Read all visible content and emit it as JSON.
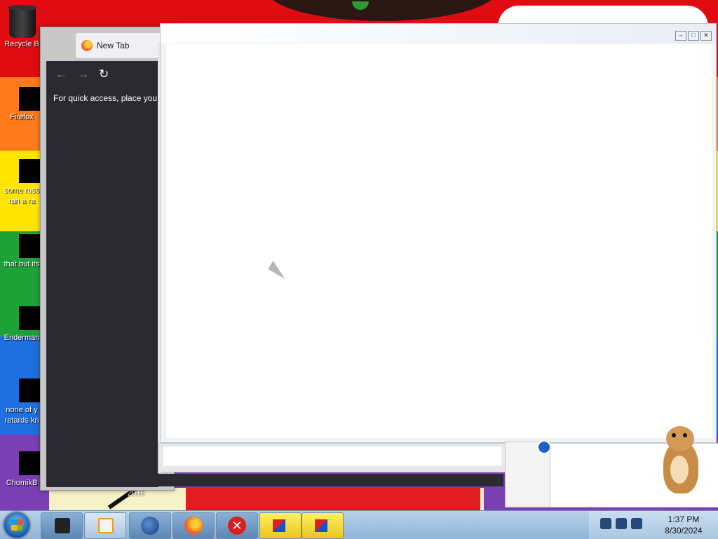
{
  "desktop": {
    "icons": [
      {
        "label": "Recycle B"
      },
      {
        "label": "Firefox"
      },
      {
        "label": "some russ",
        "label2": "ran a ra"
      },
      {
        "label": "that but its"
      },
      {
        "label": "Enderman"
      },
      {
        "label": "none of y",
        "label2": "retards kn"
      },
      {
        "label": "ChomikB"
      }
    ],
    "year_text": "2015"
  },
  "browser": {
    "tab_title": "New Tab",
    "nav_back": "←",
    "nav_forward": "→",
    "nav_reload": "↻",
    "bookmarks_hint": "For quick access, place your"
  },
  "window": {
    "minimize": "–",
    "maximize": "□",
    "close": "✕"
  },
  "tray": {
    "time": "1:37 PM",
    "date": "8/30/2024"
  },
  "colors": {
    "taskbar": "#a9c6e4",
    "firefox_bg": "#2b2a33"
  }
}
